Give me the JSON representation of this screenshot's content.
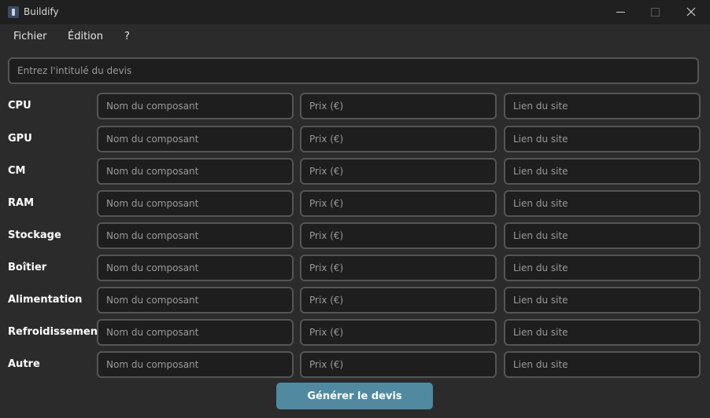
{
  "window": {
    "title": "Buildify",
    "icon": "app-icon",
    "controls": [
      "minimize-icon",
      "maximize-icon",
      "close-icon"
    ]
  },
  "menu": {
    "items": [
      "Fichier",
      "Édition",
      "?"
    ]
  },
  "quote_title": {
    "placeholder": "Entrez l'intitulé du devis",
    "value": ""
  },
  "components": [
    {
      "label": "CPU",
      "name_placeholder": "Nom du composant",
      "price_placeholder": "Prix (€)",
      "link_placeholder": "Lien du site"
    },
    {
      "label": "GPU",
      "name_placeholder": "Nom du composant",
      "price_placeholder": "Prix (€)",
      "link_placeholder": "Lien du site"
    },
    {
      "label": "CM",
      "name_placeholder": "Nom du composant",
      "price_placeholder": "Prix (€)",
      "link_placeholder": "Lien du site"
    },
    {
      "label": "RAM",
      "name_placeholder": "Nom du composant",
      "price_placeholder": "Prix (€)",
      "link_placeholder": "Lien du site"
    },
    {
      "label": "Stockage",
      "name_placeholder": "Nom du composant",
      "price_placeholder": "Prix (€)",
      "link_placeholder": "Lien du site"
    },
    {
      "label": "Boîtier",
      "name_placeholder": "Nom du composant",
      "price_placeholder": "Prix (€)",
      "link_placeholder": "Lien du site"
    },
    {
      "label": "Alimentation",
      "name_placeholder": "Nom du composant",
      "price_placeholder": "Prix (€)",
      "link_placeholder": "Lien du site"
    },
    {
      "label": "Refroidissement",
      "name_placeholder": "Nom du composant",
      "price_placeholder": "Prix (€)",
      "link_placeholder": "Lien du site"
    },
    {
      "label": "Autre",
      "name_placeholder": "Nom du composant",
      "price_placeholder": "Prix (€)",
      "link_placeholder": "Lien du site"
    }
  ],
  "actions": {
    "generate_label": "Générer le devis"
  },
  "colors": {
    "background": "#2b2b2b",
    "field_background": "#1e1e1e",
    "field_border": "#555555",
    "accent": "#4f8aa0",
    "titlebar": "#202020"
  }
}
